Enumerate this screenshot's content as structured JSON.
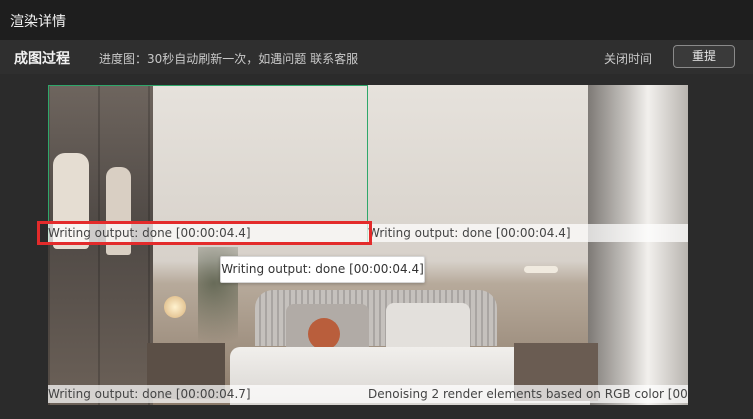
{
  "window": {
    "title": "渲染详情"
  },
  "toolbar": {
    "section_title": "成图过程",
    "progress_text": "进度图：30秒自动刷新一次，如遇问题 联系客服",
    "close_time_label": "关闭时间",
    "reset_label": "重提"
  },
  "render": {
    "tile_status_top_left": "Writing output: done [00:00:04.4]",
    "tile_status_top_right": "Writing output: done [00:00:04.4]",
    "tooltip_text": "Writing output: done [00:00:04.4]",
    "tile_status_bottom_left": "Writing output: done [00:00:04.7]",
    "tile_status_bottom_right": "Denoising 2 render elements based on RGB color [00:00"
  },
  "colors": {
    "highlight": "#e32b2b",
    "tile_border": "#2fa76a"
  }
}
